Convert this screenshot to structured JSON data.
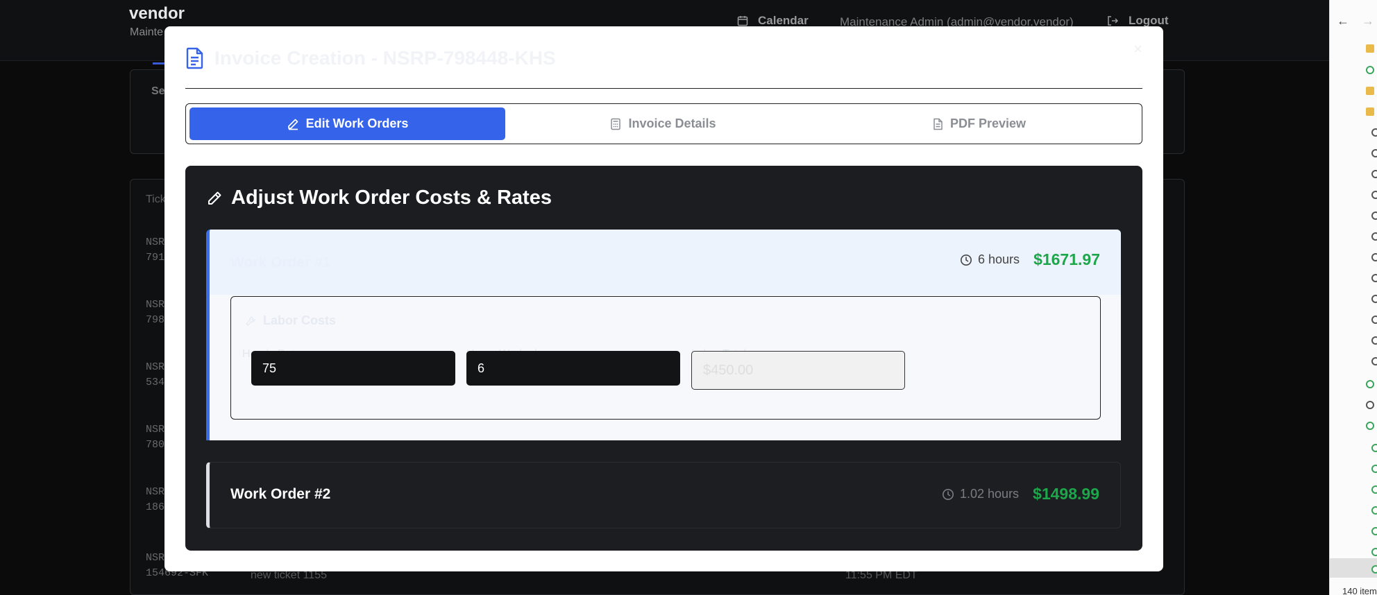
{
  "background": {
    "brand": "vendor",
    "brand_sub": "Mainte",
    "calendar_label": "Calendar",
    "user_label": "Maintenance Admin (admin@vendor.vendor)",
    "logout_label": "Logout",
    "card_label": "Se",
    "table_header": "Tick",
    "rows": [
      "NSR\n791",
      "NSR\n798",
      "NSR\n534",
      "NSR\n780",
      "NSR\n186",
      "NSR\n154692-SFK"
    ],
    "last_row_text": "new ticket 1155",
    "last_row_time": "11:55 PM EDT"
  },
  "side_panel": {
    "item_count": "140 item"
  },
  "modal": {
    "title": "Invoice Creation - NSRP-798448-KHS",
    "close_symbol": "×",
    "tabs": [
      {
        "label": "Edit Work Orders",
        "icon": "pencil-icon",
        "active": true
      },
      {
        "label": "Invoice Details",
        "icon": "calculator-icon",
        "active": false
      },
      {
        "label": "PDF Preview",
        "icon": "document-icon",
        "active": false
      }
    ],
    "panel_title": "Adjust Work Order Costs & Rates",
    "work_orders": [
      {
        "name": "Work Order #1",
        "hours": "6 hours",
        "cost": "$1671.97",
        "labor": {
          "section_title": "Labor Costs",
          "hourly_rate_label": "Hourly Rate",
          "hourly_rate_value": "75",
          "hours_worked_label": "Hours Worked",
          "hours_worked_value": "6",
          "labor_total_label": "Labor Total",
          "labor_total_value": "$450.00"
        }
      },
      {
        "name": "Work Order #2",
        "hours": "1.02 hours",
        "cost": "$1498.99"
      }
    ]
  },
  "colors": {
    "accent": "#3563e9",
    "cost_green": "#1ea64a"
  }
}
